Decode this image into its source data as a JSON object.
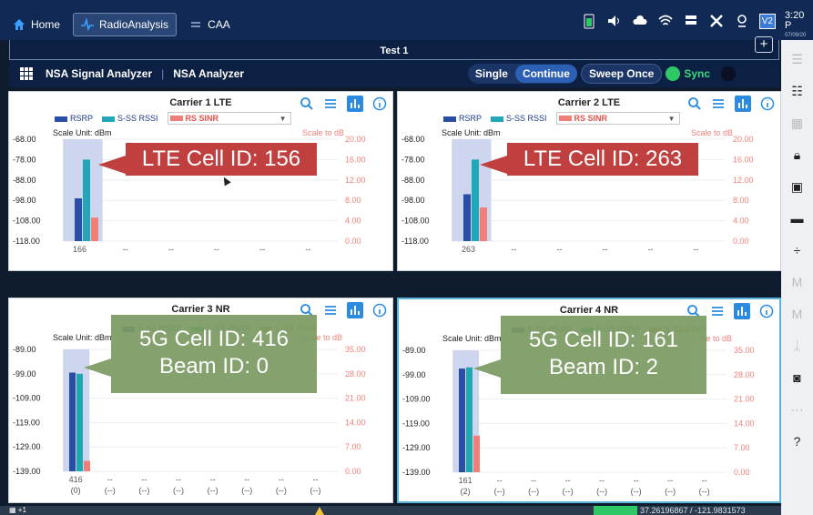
{
  "tabs": [
    {
      "label": "Home",
      "icon": "home-icon"
    },
    {
      "label": "RadioAnalysis",
      "icon": "pulse-icon"
    },
    {
      "label": "CAA",
      "icon": "caa-icon"
    }
  ],
  "clock": {
    "time": "3:20 P",
    "date": "07/09/20"
  },
  "title": "Test 1",
  "breadcrumb": {
    "app": "NSA Signal Analyzer",
    "page": "NSA Analyzer"
  },
  "controls": {
    "single": "Single",
    "continue": "Continue",
    "sweep_once": "Sweep Once",
    "sync": "Sync"
  },
  "status": {
    "vp_badge": "V2",
    "coords": "37.26196867 / -121.9831573",
    "kb_label": "+1"
  },
  "panels": [
    {
      "title": "Carrier 1 LTE",
      "legend": [
        "RSRP",
        "S-SS RSSI",
        "RS SINR"
      ],
      "legend_colors": [
        "#2a4ea6",
        "#21a7b8",
        "#f07f7a"
      ],
      "unit": "Scale Unit: dBm",
      "scale_to_db": "Scale to dB",
      "y_left": [
        "-68.00",
        "-78.00",
        "-88.00",
        "-98.00",
        "-108.00",
        "-118.00"
      ],
      "y_right": [
        "20.00",
        "16.00",
        "12.00",
        "8.00",
        "4.00",
        "0.00"
      ],
      "x_labels": [
        "166",
        "--",
        "--",
        "--",
        "--",
        "--"
      ],
      "callout": "LTE Cell ID: 156",
      "callout2": ""
    },
    {
      "title": "Carrier 2 LTE",
      "legend": [
        "RSRP",
        "S-SS RSSI",
        "RS SINR"
      ],
      "legend_colors": [
        "#2a4ea6",
        "#21a7b8",
        "#f07f7a"
      ],
      "unit": "Scale Unit: dBm",
      "scale_to_db": "Scale to dB",
      "y_left": [
        "-68.00",
        "-78.00",
        "-88.00",
        "-98.00",
        "-108.00",
        "-118.00"
      ],
      "y_right": [
        "20.00",
        "16.00",
        "12.00",
        "8.00",
        "4.00",
        "0.00"
      ],
      "x_labels": [
        "263",
        "--",
        "--",
        "--",
        "--",
        "--"
      ],
      "callout": "LTE Cell ID: 263",
      "callout2": ""
    },
    {
      "title": "Carrier 3 NR",
      "legend": [
        "S-SS RSRP",
        "S-SS RSRP",
        "S-SS SINR"
      ],
      "legend_colors": [
        "#2a4ea6",
        "#1fb07a",
        "#c58a4a"
      ],
      "unit": "Scale Unit: dBm",
      "scale_to_db": "Scale to dB",
      "y_left": [
        "-89.00",
        "-99.00",
        "-109.00",
        "-119.00",
        "-129.00",
        "-139.00"
      ],
      "y_right": [
        "35.00",
        "28.00",
        "21.00",
        "14.00",
        "7.00",
        "0.00"
      ],
      "x_labels": [
        "416",
        "--",
        "--",
        "--",
        "--",
        "--",
        "--",
        "--"
      ],
      "x_sub": [
        "(0)",
        "(--)",
        "(--)",
        "(--)",
        "(--)",
        "(--)",
        "(--)",
        "(--)"
      ],
      "callout": "5G Cell ID: 416",
      "callout2": "Beam ID: 0"
    },
    {
      "title": "Carrier 4 NR",
      "legend": [
        "S-SS RSRP",
        "S-SS RSRP",
        "S-SS SINR"
      ],
      "legend_colors": [
        "#2a4ea6",
        "#1fb07a",
        "#c58a4a"
      ],
      "unit": "Scale Unit: dBm",
      "scale_to_db": "Scale to dB",
      "y_left": [
        "-89.00",
        "-99.00",
        "-109.00",
        "-119.00",
        "-129.00",
        "-139.00"
      ],
      "y_right": [
        "35.00",
        "28.00",
        "21.00",
        "14.00",
        "7.00",
        "0.00"
      ],
      "x_labels": [
        "161",
        "--",
        "--",
        "--",
        "--",
        "--",
        "--",
        "--"
      ],
      "x_sub": [
        "(2)",
        "(--)",
        "(--)",
        "(--)",
        "(--)",
        "(--)",
        "(--)",
        "(--)"
      ],
      "callout": "5G Cell ID: 161",
      "callout2": "Beam ID: 2"
    }
  ],
  "chart_data": [
    {
      "type": "bar",
      "categories": [
        "166"
      ],
      "series": [
        {
          "name": "RSRP",
          "values": [
            -97
          ]
        },
        {
          "name": "S-SS RSSI",
          "values": [
            -78
          ]
        }
      ],
      "secondary": [
        {
          "name": "RS SINR",
          "values": [
            4.6
          ]
        }
      ],
      "ylim": [
        -118,
        -68
      ],
      "y2lim": [
        0,
        20
      ]
    },
    {
      "type": "bar",
      "categories": [
        "263"
      ],
      "series": [
        {
          "name": "RSRP",
          "values": [
            -95
          ]
        },
        {
          "name": "S-SS RSSI",
          "values": [
            -78
          ]
        }
      ],
      "secondary": [
        {
          "name": "RS SINR",
          "values": [
            6.6
          ]
        }
      ],
      "ylim": [
        -118,
        -68
      ],
      "y2lim": [
        0,
        20
      ]
    },
    {
      "type": "bar",
      "categories": [
        "416"
      ],
      "series": [
        {
          "name": "S-SS RSRP",
          "values": [
            -98.5
          ]
        },
        {
          "name": "S-SS RSRP",
          "values": [
            -99
          ]
        }
      ],
      "secondary": [
        {
          "name": "S-SS SINR",
          "values": [
            3
          ]
        }
      ],
      "ylim": [
        -139,
        -89
      ],
      "y2lim": [
        0,
        35
      ]
    },
    {
      "type": "bar",
      "categories": [
        "161"
      ],
      "series": [
        {
          "name": "S-SS RSRP",
          "values": [
            -96.5
          ]
        },
        {
          "name": "S-SS RSRP",
          "values": [
            -96
          ]
        }
      ],
      "secondary": [
        {
          "name": "S-SS SINR",
          "values": [
            10.5
          ]
        }
      ],
      "ylim": [
        -139,
        -89
      ],
      "y2lim": [
        0,
        35
      ]
    }
  ]
}
